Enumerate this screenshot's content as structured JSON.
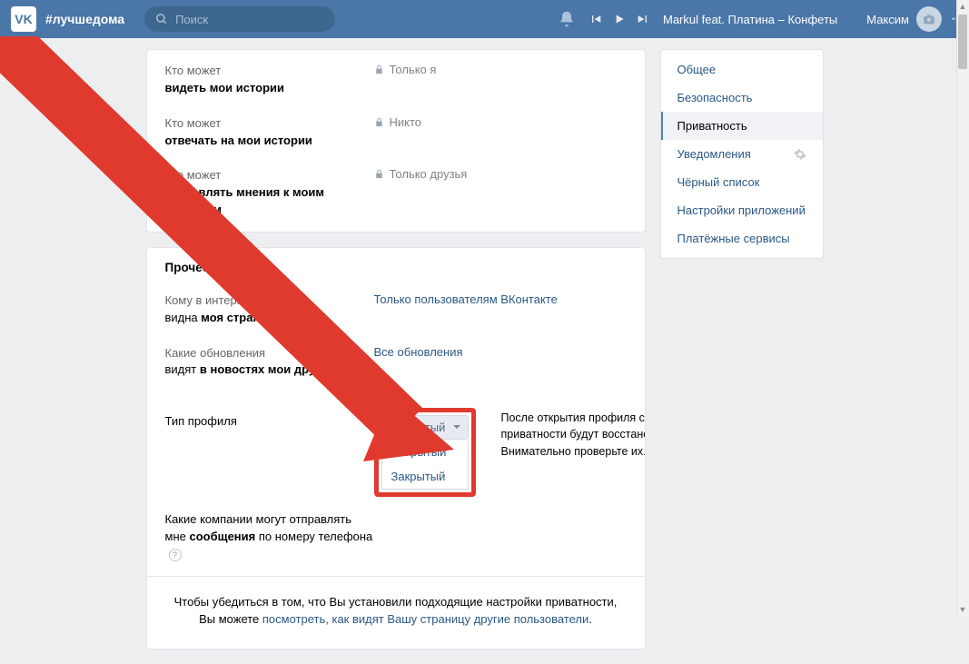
{
  "header": {
    "hashtag": "#лучшедома",
    "search_placeholder": "Поиск",
    "track": "Markul feat. Платина – Конфеты",
    "username": "Максим"
  },
  "sidebar": {
    "items": [
      {
        "label": "Общее"
      },
      {
        "label": "Безопасность"
      },
      {
        "label": "Приватность"
      },
      {
        "label": "Уведомления"
      },
      {
        "label": "Чёрный список"
      },
      {
        "label": "Настройки приложений"
      },
      {
        "label": "Платёжные сервисы"
      }
    ]
  },
  "rows_stories": [
    {
      "q": "Кто может",
      "b": "видеть мои истории",
      "val": "Только я",
      "locked": true
    },
    {
      "q": "Кто может",
      "b": "отвечать на мои истории",
      "val": "Никто",
      "locked": true
    },
    {
      "q": "Кто может",
      "b": "отправлять мнения к моим историям",
      "val": "Только друзья",
      "locked": true
    }
  ],
  "section_other": "Прочее",
  "rows_other": [
    {
      "q": "Кому в интернете",
      "b": "видна моя страница",
      "val": "Только пользователям ВКонтакте"
    },
    {
      "q_full": "Какие обновления видят ",
      "b": "в новостях мои друзья",
      "val": "Все обновления"
    }
  ],
  "profile_type": {
    "label": "Тип профиля",
    "selected": "Закрытый",
    "options": [
      "Открытый",
      "Закрытый"
    ],
    "tooltip": "После открытия профиля старые настройки приватности будут восстановлены. Внимательно проверьте их."
  },
  "row_companies": {
    "part1": "Какие компании могут отправлять мне ",
    "bold": "сообщения",
    "part2": " по номеру телефона"
  },
  "footer": {
    "line1": "Чтобы убедиться в том, что Вы установили подходящие настройки приватности,",
    "line2_pre": "Вы можете ",
    "link": "посмотреть, как видят Вашу страницу другие пользователи",
    "line2_post": "."
  }
}
